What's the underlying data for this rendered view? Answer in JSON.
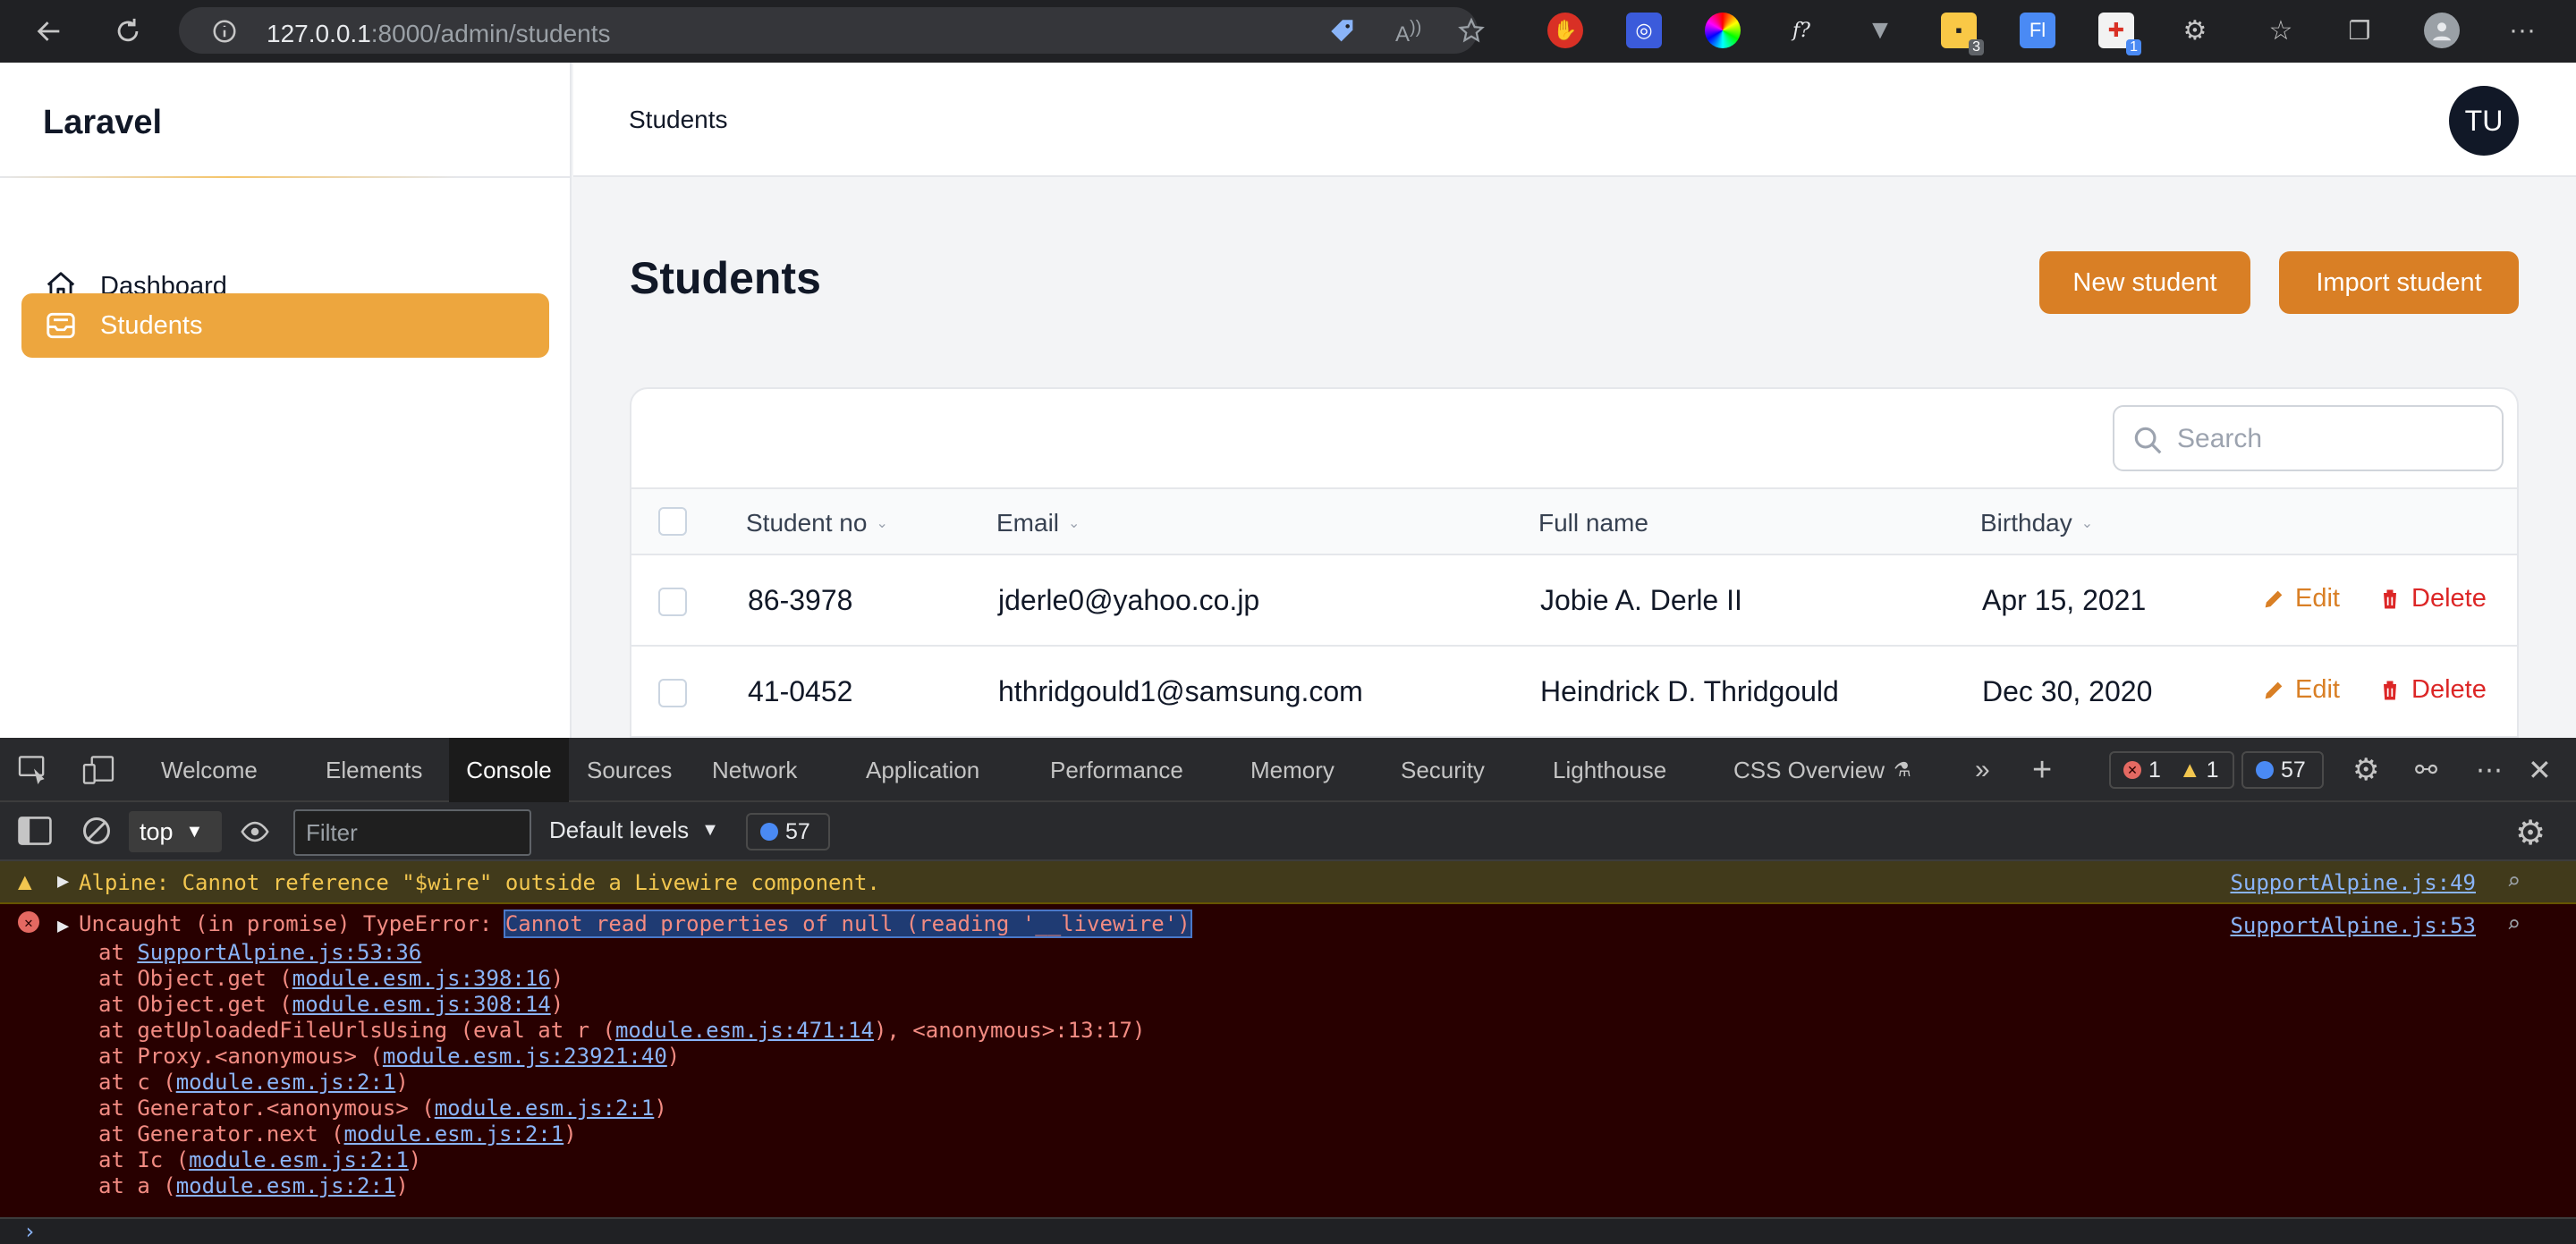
{
  "browser": {
    "url_host": "127.0.0.1",
    "url_path": ":8000/admin/students",
    "extension_badges": {
      "ext5": "3",
      "ext7": "1"
    }
  },
  "sidebar": {
    "brand": "Laravel",
    "items": [
      {
        "label": "Dashboard",
        "icon": "home-icon",
        "active": false
      },
      {
        "label": "Students",
        "icon": "inbox-icon",
        "active": true
      }
    ]
  },
  "topbar": {
    "title": "Students",
    "avatar_initials": "TU"
  },
  "main": {
    "page_title": "Students",
    "new_button": "New student",
    "import_button": "Import student",
    "search_placeholder": "Search",
    "columns": [
      "Student no",
      "Email",
      "Full name",
      "Birthday"
    ],
    "rows": [
      {
        "student_no": "86-3978",
        "email": "jderle0@yahoo.co.jp",
        "full_name": "Jobie A. Derle II",
        "birthday": "Apr 15, 2021",
        "edit": "Edit",
        "delete": "Delete"
      },
      {
        "student_no": "41-0452",
        "email": "hthridgould1@samsung.com",
        "full_name": "Heindrick D. Thridgould",
        "birthday": "Dec 30, 2020",
        "edit": "Edit",
        "delete": "Delete"
      }
    ]
  },
  "devtools": {
    "tabs": [
      "Welcome",
      "Elements",
      "Console",
      "Sources",
      "Network",
      "Application",
      "Performance",
      "Memory",
      "Security",
      "Lighthouse",
      "CSS Overview"
    ],
    "active_tab": "Console",
    "error_count": "1",
    "warning_count": "1",
    "message_count": "57",
    "context": "top",
    "filter_placeholder": "Filter",
    "levels": "Default levels",
    "toolbar_message_count": "57",
    "warning": {
      "text": "Alpine: Cannot reference \"$wire\" outside a Livewire component.",
      "source": "SupportAlpine.js:49"
    },
    "error": {
      "prefix": "Uncaught (in promise) TypeError: ",
      "message": "Cannot read properties of null (reading '__livewire')",
      "source": "SupportAlpine.js:53",
      "stack": [
        {
          "pre": "at ",
          "link": "SupportAlpine.js:53:36",
          "post": ""
        },
        {
          "pre": "at Object.get (",
          "link": "module.esm.js:398:16",
          "post": ")"
        },
        {
          "pre": "at Object.get (",
          "link": "module.esm.js:308:14",
          "post": ")"
        },
        {
          "pre": "at getUploadedFileUrlsUsing (eval at r (",
          "link": "module.esm.js:471:14",
          "post": "), <anonymous>:13:17)"
        },
        {
          "pre": "at Proxy.<anonymous> (",
          "link": "module.esm.js:23921:40",
          "post": ")"
        },
        {
          "pre": "at c (",
          "link": "module.esm.js:2:1",
          "post": ")"
        },
        {
          "pre": "at Generator.<anonymous> (",
          "link": "module.esm.js:2:1",
          "post": ")"
        },
        {
          "pre": "at Generator.next (",
          "link": "module.esm.js:2:1",
          "post": ")"
        },
        {
          "pre": "at Ic (",
          "link": "module.esm.js:2:1",
          "post": ")"
        },
        {
          "pre": "at a (",
          "link": "module.esm.js:2:1",
          "post": ")"
        }
      ]
    }
  },
  "colors": {
    "accent": "#d97f25",
    "sidebar_active": "#eda63e",
    "danger": "#dc2626",
    "devtools_error_bg": "#280000",
    "devtools_warning_bg": "#413a1b"
  }
}
